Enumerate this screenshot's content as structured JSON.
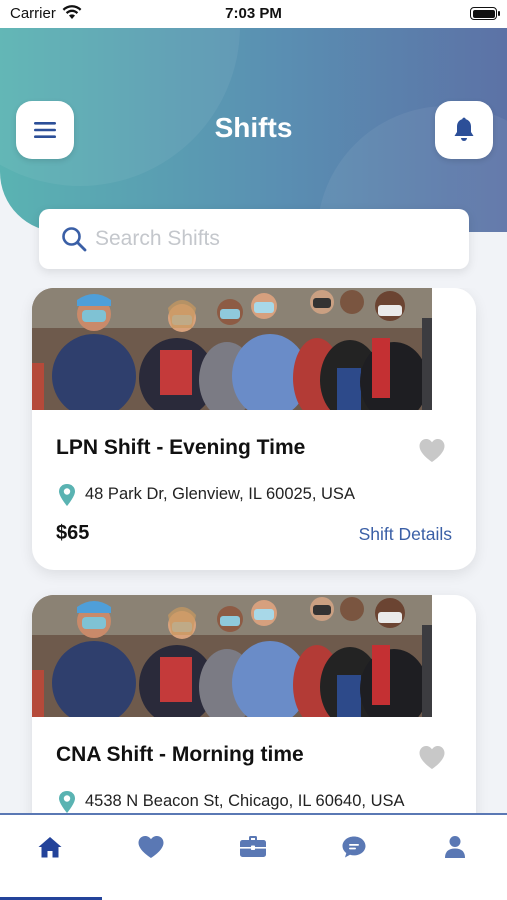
{
  "status_bar": {
    "carrier": "Carrier",
    "time": "7:03 PM"
  },
  "header": {
    "title": "Shifts",
    "menu_icon": "hamburger-menu-icon",
    "bell_icon": "bell-icon"
  },
  "search": {
    "placeholder": "Search Shifts",
    "value": ""
  },
  "shifts": [
    {
      "title": "LPN Shift - Evening Time",
      "address": "48 Park Dr, Glenview, IL 60025, USA",
      "price": "$65",
      "details_label": "Shift Details",
      "favorited": false
    },
    {
      "title": "CNA Shift - Morning time",
      "address": "4538 N Beacon St, Chicago, IL 60640, USA",
      "price": "",
      "details_label": "",
      "favorited": false
    }
  ],
  "tab_bar": {
    "items": [
      {
        "icon": "home-icon",
        "active": true
      },
      {
        "icon": "heart-icon",
        "active": false
      },
      {
        "icon": "briefcase-icon",
        "active": false
      },
      {
        "icon": "chat-icon",
        "active": false
      },
      {
        "icon": "profile-icon",
        "active": false
      }
    ]
  },
  "colors": {
    "header_gradient_start": "#5ab3b2",
    "header_gradient_end": "#5c72a6",
    "link": "#3a5fa6",
    "tab_active": "#23439a",
    "tab_inactive": "#5a78b4",
    "pin": "#5ab3b2",
    "heart_inactive": "#c8c8c8"
  }
}
